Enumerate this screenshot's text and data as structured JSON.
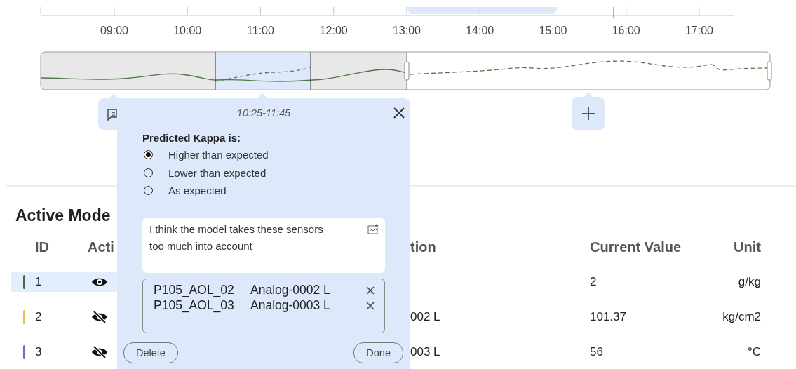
{
  "timeline": {
    "hours": [
      "09:00",
      "10:00",
      "11:00",
      "12:00",
      "13:00",
      "14:00",
      "15:00",
      "16:00",
      "17:00"
    ]
  },
  "annotation_popup": {
    "time_range": "10:25-11:45",
    "question": "Predicted Kappa is:",
    "options": [
      {
        "label": "Higher than expected",
        "selected": true
      },
      {
        "label": "Lower than expected",
        "selected": false
      },
      {
        "label": "As expected",
        "selected": false
      }
    ],
    "comment": "I think the model takes these sensors too much into account",
    "sensors": [
      {
        "tag": "P105_AOL_02",
        "name": "Analog-0002 L"
      },
      {
        "tag": "P105_AOL_03",
        "name": "Analog-0003 L"
      }
    ],
    "delete_label": "Delete",
    "done_label": "Done"
  },
  "table": {
    "title": "Active Mode",
    "columns": [
      "ID",
      "Acti",
      "tion",
      "Current Value",
      "Unit"
    ],
    "rows": [
      {
        "id": "1",
        "color": "#3f6e38",
        "visible": true,
        "selected": true,
        "value": "2",
        "unit": "g/kg"
      },
      {
        "id": "2",
        "color": "#e2c043",
        "visible": false,
        "selected": false,
        "description": "002 L",
        "value": "101.37",
        "unit": "kg/cm2"
      },
      {
        "id": "3",
        "color": "#5b70d6",
        "visible": false,
        "selected": false,
        "description": "003 L",
        "value": "56",
        "unit": "°C"
      }
    ]
  }
}
